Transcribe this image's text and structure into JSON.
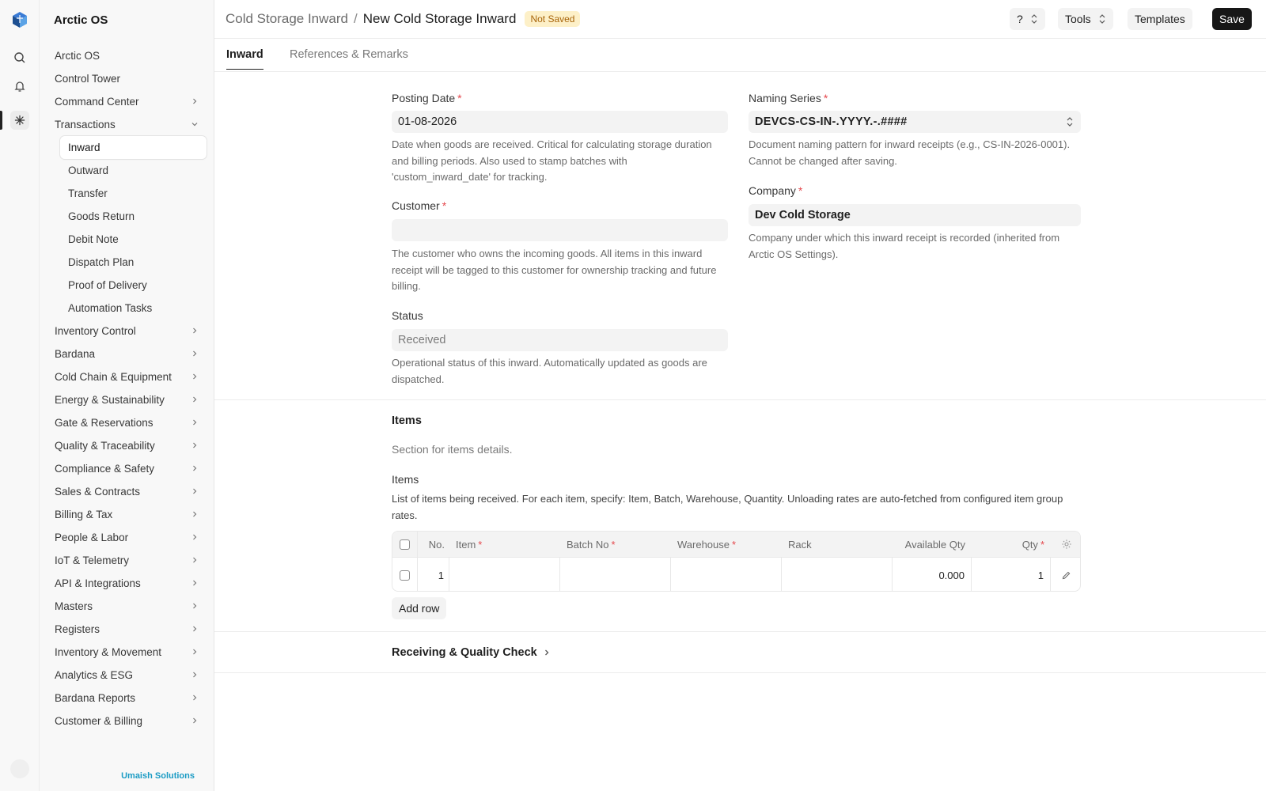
{
  "app": {
    "name": "Arctic OS",
    "footer_brand": "Umaish Solutions"
  },
  "sidebar": {
    "items": [
      {
        "label": "Arctic OS",
        "expandable": false
      },
      {
        "label": "Control Tower",
        "expandable": false
      },
      {
        "label": "Command Center",
        "expandable": true
      },
      {
        "label": "Transactions",
        "expandable": true,
        "expanded": true
      }
    ],
    "sub_items": [
      "Inward",
      "Outward",
      "Transfer",
      "Goods Return",
      "Debit Note",
      "Dispatch Plan",
      "Proof of Delivery",
      "Automation Tasks"
    ],
    "active_sub": "Inward",
    "more_items": [
      "Inventory Control",
      "Bardana",
      "Cold Chain & Equipment",
      "Energy & Sustainability",
      "Gate & Reservations",
      "Quality & Traceability",
      "Compliance & Safety",
      "Sales & Contracts",
      "Billing & Tax",
      "People & Labor",
      "IoT & Telemetry",
      "API & Integrations",
      "Masters",
      "Registers",
      "Inventory & Movement",
      "Analytics & ESG",
      "Bardana Reports",
      "Customer & Billing"
    ]
  },
  "header": {
    "breadcrumb_parent": "Cold Storage Inward",
    "breadcrumb_sep": "/",
    "title": "New Cold Storage Inward",
    "badge": "Not Saved",
    "help_label": "?",
    "tools_label": "Tools",
    "templates_label": "Templates",
    "save_label": "Save"
  },
  "tabs": {
    "inward": "Inward",
    "references": "References & Remarks"
  },
  "form": {
    "posting_date": {
      "label": "Posting Date",
      "value": "01-08-2026",
      "help": "Date when goods are received. Critical for calculating storage duration and billing periods. Also used to stamp batches with 'custom_inward_date' for tracking."
    },
    "customer": {
      "label": "Customer",
      "value": "",
      "help": "The customer who owns the incoming goods. All items in this inward receipt will be tagged to this customer for ownership tracking and future billing."
    },
    "status": {
      "label": "Status",
      "value": "Received",
      "help": "Operational status of this inward. Automatically updated as goods are dispatched."
    },
    "naming_series": {
      "label": "Naming Series",
      "value": "DEVCS-CS-IN-.YYYY.-.####",
      "help": "Document naming pattern for inward receipts (e.g., CS-IN-2026-0001). Cannot be changed after saving."
    },
    "company": {
      "label": "Company",
      "value": "Dev Cold Storage",
      "help": "Company under which this inward receipt is recorded (inherited from Arctic OS Settings)."
    }
  },
  "items_section": {
    "title": "Items",
    "description": "Section for items details.",
    "table_label": "Items",
    "table_help": "List of items being received. For each item, specify: Item, Batch, Warehouse, Quantity. Unloading rates are auto-fetched from configured item group rates.",
    "columns": {
      "no": "No.",
      "item": "Item",
      "batch_no": "Batch No",
      "warehouse": "Warehouse",
      "rack": "Rack",
      "available_qty": "Available Qty",
      "qty": "Qty"
    },
    "rows": [
      {
        "no": "1",
        "item": "",
        "batch_no": "",
        "warehouse": "",
        "rack": "",
        "available_qty": "0.000",
        "qty": "1"
      }
    ],
    "add_row_label": "Add row"
  },
  "receiving_section": {
    "title": "Receiving & Quality Check"
  },
  "colors": {
    "accent": "#171717",
    "badge_bg": "#fdf0c8",
    "badge_text": "#a8650b",
    "required": "#e5484d",
    "brand_link": "#1a9bc4"
  }
}
